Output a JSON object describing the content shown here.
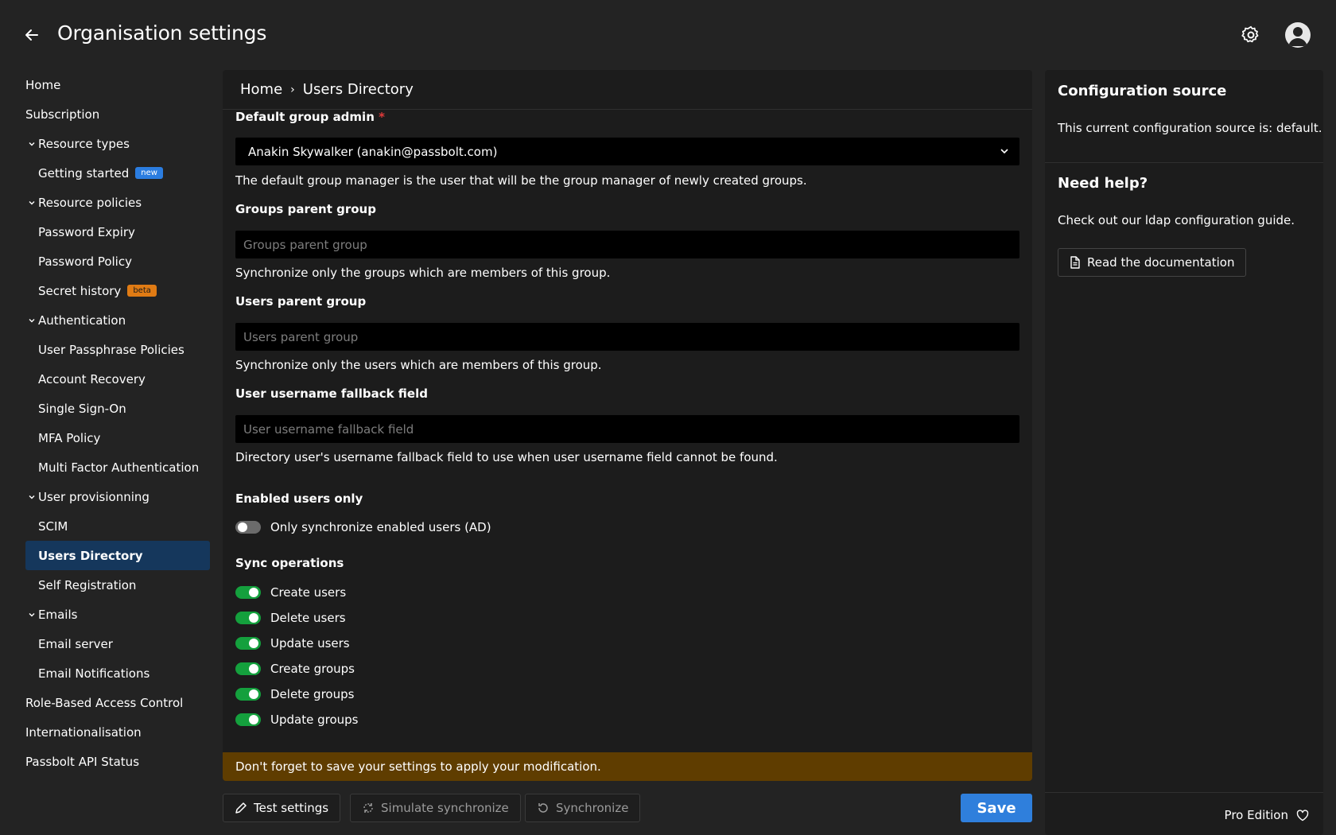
{
  "header": {
    "title": "Organisation settings",
    "back_icon": "arrow-left-icon",
    "settings_icon": "gear-icon",
    "avatar_icon": "user-avatar-icon"
  },
  "sidebar": {
    "items": [
      {
        "label": "Home",
        "level": 0
      },
      {
        "label": "Subscription",
        "level": 0
      },
      {
        "label": "Resource types",
        "level": "group"
      },
      {
        "label": "Getting started",
        "level": 1,
        "badge": "new"
      },
      {
        "label": "Resource policies",
        "level": "group"
      },
      {
        "label": "Password Expiry",
        "level": 1
      },
      {
        "label": "Password Policy",
        "level": 1
      },
      {
        "label": "Secret history",
        "level": 1,
        "badge": "beta"
      },
      {
        "label": "Authentication",
        "level": "group"
      },
      {
        "label": "User Passphrase Policies",
        "level": 1
      },
      {
        "label": "Account Recovery",
        "level": 1
      },
      {
        "label": "Single Sign-On",
        "level": 1
      },
      {
        "label": "MFA Policy",
        "level": 1
      },
      {
        "label": "Multi Factor Authentication",
        "level": 1
      },
      {
        "label": "User provisionning",
        "level": "group"
      },
      {
        "label": "SCIM",
        "level": 1
      },
      {
        "label": "Users Directory",
        "level": 1,
        "selected": true
      },
      {
        "label": "Self Registration",
        "level": 1
      },
      {
        "label": "Emails",
        "level": "group"
      },
      {
        "label": "Email server",
        "level": 1
      },
      {
        "label": "Email Notifications",
        "level": 1
      },
      {
        "label": "Role-Based Access Control",
        "level": 0
      },
      {
        "label": "Internationalisation",
        "level": 0
      },
      {
        "label": "Passbolt API Status",
        "level": 0
      }
    ]
  },
  "breadcrumb": {
    "home": "Home",
    "separator": "›",
    "current": "Users Directory"
  },
  "form": {
    "default_group_admin": {
      "label": "Default group admin",
      "required_mark": "*",
      "value": "Anakin Skywalker (anakin@passbolt.com)",
      "help": "The default group manager is the user that will be the group manager of newly created groups."
    },
    "groups_parent_group": {
      "label": "Groups parent group",
      "placeholder": "Groups parent group",
      "help": "Synchronize only the groups which are members of this group."
    },
    "users_parent_group": {
      "label": "Users parent group",
      "placeholder": "Users parent group",
      "help": "Synchronize only the users which are members of this group."
    },
    "user_username_fallback": {
      "label": "User username fallback field",
      "placeholder": "User username fallback field",
      "help": "Directory user's username fallback field to use when user username field cannot be found."
    },
    "enabled_users_only": {
      "label": "Enabled users only",
      "toggle_label": "Only synchronize enabled users (AD)",
      "enabled": false
    },
    "sync_operations": {
      "label": "Sync operations",
      "items": [
        {
          "label": "Create users",
          "enabled": true
        },
        {
          "label": "Delete users",
          "enabled": true
        },
        {
          "label": "Update users",
          "enabled": true
        },
        {
          "label": "Create groups",
          "enabled": true
        },
        {
          "label": "Delete groups",
          "enabled": true
        },
        {
          "label": "Update groups",
          "enabled": true
        }
      ]
    }
  },
  "warning": "Don't forget to save your settings to apply your modification.",
  "actions": {
    "test_settings": "Test settings",
    "simulate_synchronize": "Simulate synchronize",
    "synchronize": "Synchronize",
    "save": "Save"
  },
  "right_panel": {
    "config_title": "Configuration source",
    "config_text": "This current configuration source is: default.",
    "help_title": "Need help?",
    "help_text": "Check out our ldap configuration guide.",
    "doc_button": "Read the documentation",
    "edition": "Pro Edition"
  },
  "colors": {
    "background": "#232323",
    "panel": "#1c1c1c",
    "selected_nav": "#15375c",
    "toggle_on": "#14a03d",
    "warning_bg": "#5f3d00",
    "save_button": "#2f7fdc",
    "required": "#e03a3a"
  }
}
